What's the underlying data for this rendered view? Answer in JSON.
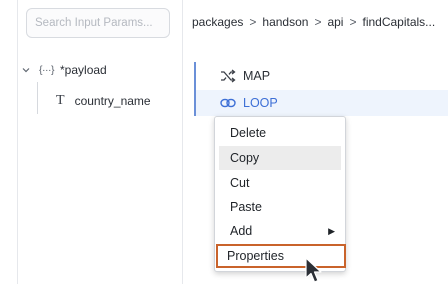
{
  "search": {
    "placeholder": "Search Input Params..."
  },
  "tree": {
    "root": {
      "brace": "{···}",
      "label": "*payload"
    },
    "child": {
      "type_glyph": "T",
      "label": "country_name"
    }
  },
  "breadcrumb": {
    "items": [
      "packages",
      "handson",
      "api",
      "findCapitals..."
    ],
    "separator": ">"
  },
  "flow": {
    "items": [
      {
        "icon": "shuffle-icon",
        "label": "MAP"
      },
      {
        "icon": "loop-icon",
        "label": "LOOP"
      }
    ]
  },
  "context_menu": {
    "items": [
      {
        "label": "Delete"
      },
      {
        "label": "Copy"
      },
      {
        "label": "Cut"
      },
      {
        "label": "Paste"
      },
      {
        "label": "Add",
        "submenu_glyph": "▶"
      },
      {
        "label": "Properties"
      }
    ]
  },
  "colors": {
    "accent_blue": "#3d6fd6",
    "selection_bg": "#eef4fd",
    "focus_outline": "#c9632b"
  }
}
